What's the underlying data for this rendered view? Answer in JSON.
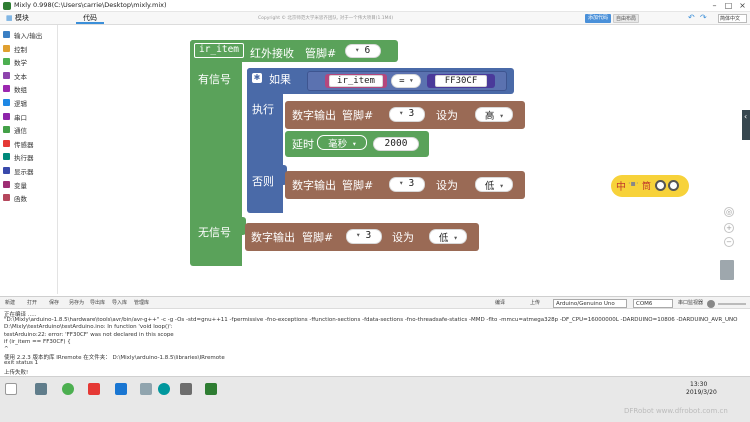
{
  "window": {
    "title": "Mixly 0.998(C:\\Users\\carrie\\Desktop\\mixly.mix)",
    "min_icon": "minimize-icon",
    "max_icon": "maximize-icon",
    "close_icon": "close-icon"
  },
  "header": {
    "modules_label": "模块",
    "code_tab": "代码",
    "copyright": "Copyright © 北京师范大学米思齐团队, 对于一个伟大项目(1.1M4)",
    "btn_blue": "添加代码",
    "btn_gray": "自由布局",
    "language": "简体中文",
    "undo_icon": "undo-icon",
    "redo_icon": "redo-icon",
    "settings_icon": "gear-icon"
  },
  "sidebar": {
    "items": [
      {
        "label": "输入/输出",
        "color": "#3a7fc4"
      },
      {
        "label": "控制",
        "color": "#e0a030"
      },
      {
        "label": "数学",
        "color": "#4caf50"
      },
      {
        "label": "文本",
        "color": "#8e44ad"
      },
      {
        "label": "数组",
        "color": "#9c27b0"
      },
      {
        "label": "逻辑",
        "color": "#1e88e5"
      },
      {
        "label": "串口",
        "color": "#8e24aa"
      },
      {
        "label": "通信",
        "color": "#43a047"
      },
      {
        "label": "传感器",
        "color": "#e53935"
      },
      {
        "label": "执行器",
        "color": "#00897b"
      },
      {
        "label": "显示器",
        "color": "#3949ab"
      },
      {
        "label": "变量",
        "color": "#9e2d73"
      },
      {
        "label": "函数",
        "color": "#b5475d"
      }
    ]
  },
  "workspace": {
    "colors": {
      "ir_block": "#5aa25a",
      "logic": "#4a6aa8",
      "output": "#9a6a55",
      "delay": "#5aa25a"
    },
    "ir_block": {
      "var_name": "ir_item",
      "label": "红外接收",
      "pin_label": "管脚#",
      "pin": "6",
      "has_signal": "有信号",
      "no_signal": "无信号"
    },
    "if_block": {
      "if_label": "如果",
      "do_label": "执行",
      "else_label": "否则",
      "compare_var": "ir_item",
      "operator": "=",
      "hex_value": "FF30CF"
    },
    "out1": {
      "label": "数字输出",
      "pin_label": "管脚#",
      "pin": "3",
      "set_label": "设为",
      "value": "高"
    },
    "delay": {
      "label": "延时",
      "unit": "毫秒",
      "value": "2000"
    },
    "out2": {
      "label": "数字输出",
      "pin_label": "管脚#",
      "pin": "3",
      "set_label": "设为",
      "value": "低"
    },
    "out3": {
      "label": "数字输出",
      "pin_label": "管脚#",
      "pin": "3",
      "set_label": "设为",
      "value": "低"
    },
    "helper_badge": "中",
    "helper_icon": "minion-eyes-icon"
  },
  "toolbar": {
    "new": "新建",
    "open": "打开",
    "save": "保存",
    "save_as": "另存为",
    "export": "导出库",
    "import": "导入库",
    "manage": "管理库",
    "compile": "编译",
    "upload": "上传",
    "board": "Arduino/Genuino Uno",
    "port": "COM6",
    "serial_monitor": "串口监视器",
    "zoom_icon": "zoom-slider-icon"
  },
  "console": {
    "lines": [
      "正在编译 .....",
      "\"D:\\Mixly\\arduino-1.8.5\\hardware\\tools\\avr/bin/avr-g++\" -c -g -Os  -std=gnu++11 -fpermissive -fno-exceptions -ffunction-sections -fdata-sections -fno-threadsafe-statics -MMD -flto -mmcu=atmega328p -DF_CPU=16000000L -DARDUINO=10806 -DARDUINO_AVR_UNO",
      "D:\\Mixly\\testArduino\\testArduino.ino: In function 'void loop()':",
      "testArduino:22: error: 'FF30CF' was not declared in this scope",
      "     if (ir_item == FF30CF) {",
      "                        ^",
      "使用 2.2.3  版本的库 IRremote 在文件夹：  D:\\Mixly\\arduino-1.8.5\\libraries\\IRremote",
      "exit status 1",
      "上传失败!"
    ]
  },
  "taskbar": {
    "time": "13:30",
    "date": "2019/3/20",
    "watermark": "DFRobot www.dfrobot.com.cn"
  }
}
